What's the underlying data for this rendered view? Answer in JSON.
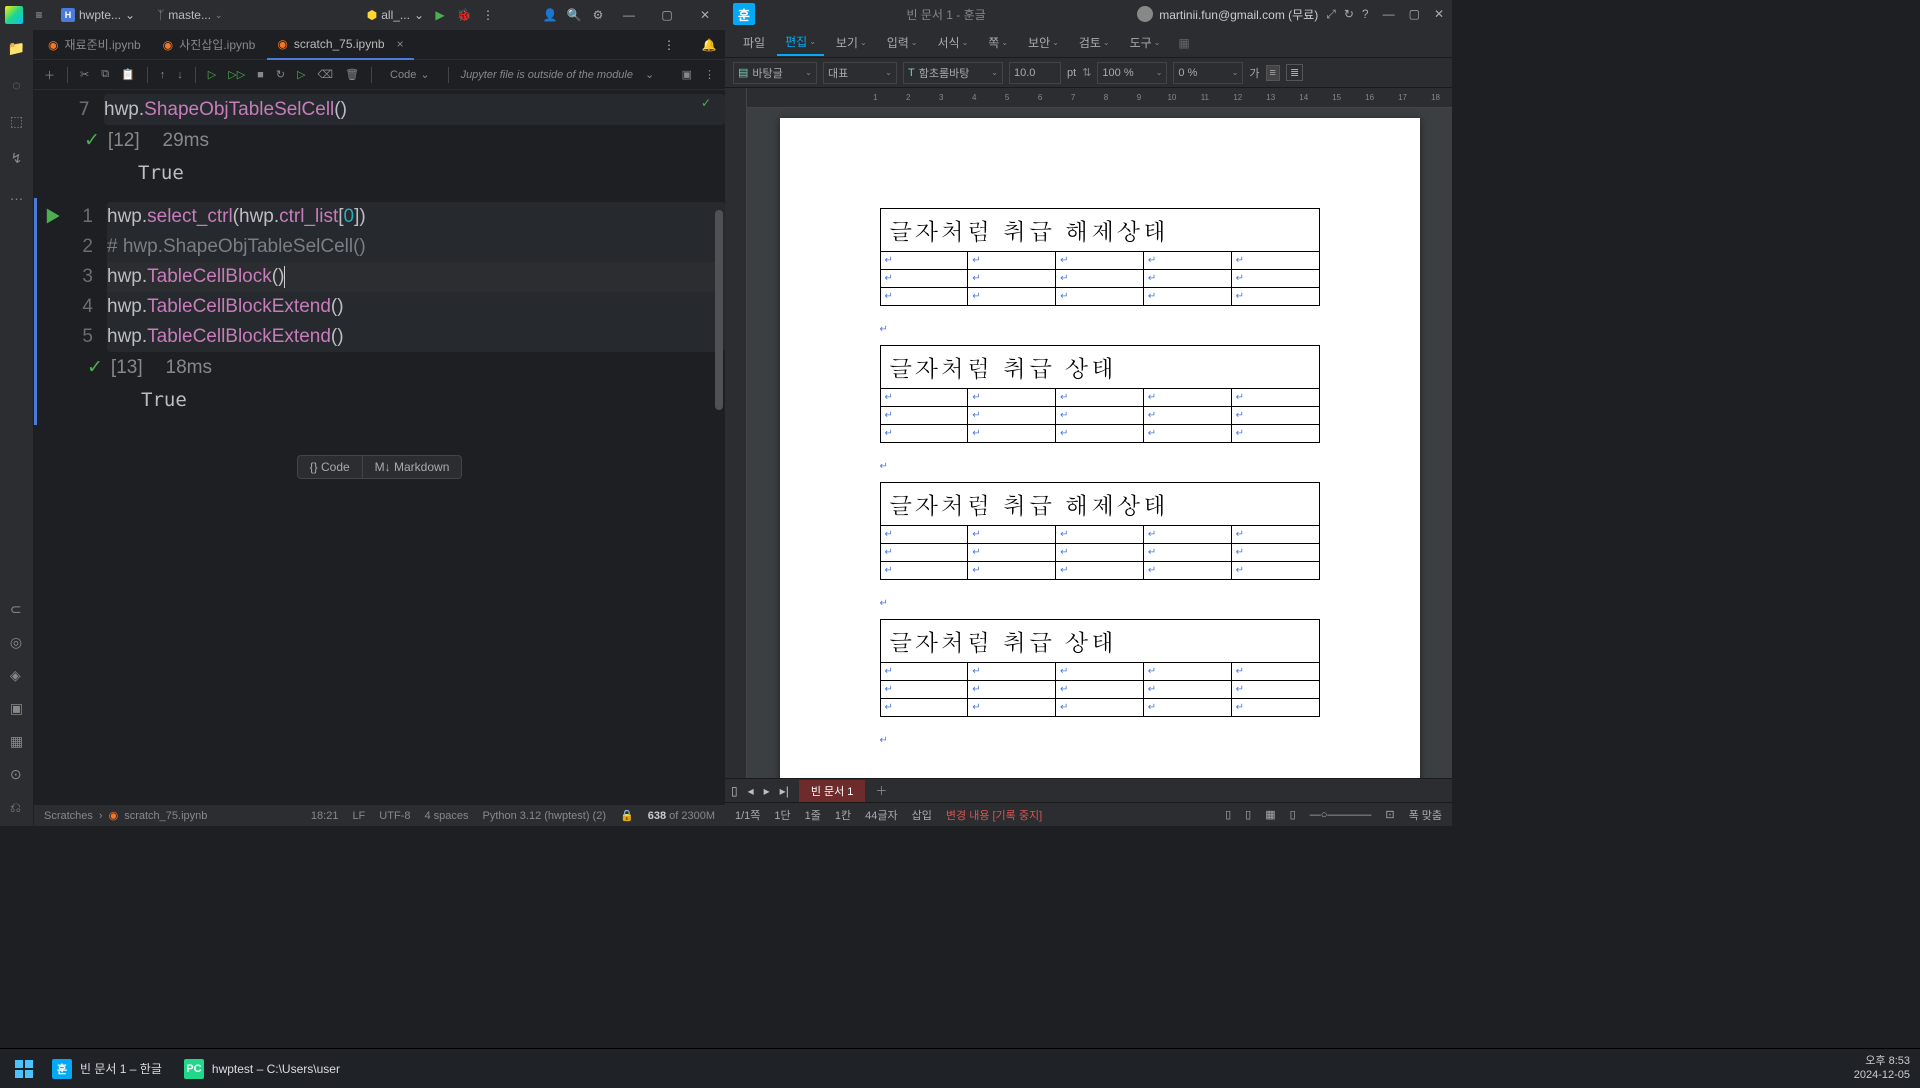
{
  "ide": {
    "project_name": "hwpte...",
    "git_branch": "maste...",
    "run_config": "all_...",
    "tabs": [
      {
        "name": "재료준비.ipynb",
        "active": false
      },
      {
        "name": "사진삽입.ipynb",
        "active": false
      },
      {
        "name": "scratch_75.ipynb",
        "active": true
      }
    ],
    "toolbar": {
      "lang_select": "Code",
      "warning": "Jupyter file is outside of the module"
    },
    "cells": [
      {
        "line_start": 7,
        "lines": [
          [
            {
              "t": "hwp",
              "c": "c-id"
            },
            {
              "t": ".",
              "c": "c-id"
            },
            {
              "t": "ShapeObjTableSelCell",
              "c": "c-prop"
            },
            {
              "t": "()",
              "c": "c-paren"
            }
          ]
        ],
        "exec_count": "[12]",
        "exec_time": "29ms",
        "output": "True",
        "has_run_marker": false,
        "check_top_right": true
      },
      {
        "line_start": 1,
        "lines": [
          [
            {
              "t": "hwp",
              "c": "c-id"
            },
            {
              "t": ".",
              "c": "c-id"
            },
            {
              "t": "select_ctrl",
              "c": "c-prop"
            },
            {
              "t": "(",
              "c": "c-paren"
            },
            {
              "t": "hwp",
              "c": "c-id"
            },
            {
              "t": ".",
              "c": "c-id"
            },
            {
              "t": "ctrl_list",
              "c": "c-prop"
            },
            {
              "t": "[",
              "c": "c-brack"
            },
            {
              "t": "0",
              "c": "c-num"
            },
            {
              "t": "]",
              "c": "c-brack"
            },
            {
              "t": ")",
              "c": "c-paren"
            }
          ],
          [
            {
              "t": "# hwp.ShapeObjTableSelCell()",
              "c": "c-comment"
            }
          ],
          [
            {
              "t": "hwp",
              "c": "c-id"
            },
            {
              "t": ".",
              "c": "c-id"
            },
            {
              "t": "TableCellBlock",
              "c": "c-prop"
            },
            {
              "t": "()",
              "c": "c-paren"
            }
          ],
          [
            {
              "t": "hwp",
              "c": "c-id"
            },
            {
              "t": ".",
              "c": "c-id"
            },
            {
              "t": "TableCellBlockExtend",
              "c": "c-prop"
            },
            {
              "t": "()",
              "c": "c-paren"
            }
          ],
          [
            {
              "t": "hwp",
              "c": "c-id"
            },
            {
              "t": ".",
              "c": "c-id"
            },
            {
              "t": "TableCellBlockExtend",
              "c": "c-prop"
            },
            {
              "t": "()",
              "c": "c-paren"
            }
          ]
        ],
        "cursor_line": 3,
        "exec_count": "[13]",
        "exec_time": "18ms",
        "output": "True",
        "has_run_marker": true
      }
    ],
    "add_buttons": {
      "code": "Code",
      "markdown": "Markdown"
    },
    "status": {
      "breadcrumb": [
        "Scratches",
        "scratch_75.ipynb"
      ],
      "cursor": "18:21",
      "line_sep": "LF",
      "encoding": "UTF-8",
      "indent": "4 spaces",
      "interpreter": "Python 3.12 (hwptest) (2)",
      "mem": "638 of 2300M"
    }
  },
  "hwp": {
    "doc_title": "빈 문서 1 - 훈글",
    "user": "martinii.fun@gmail.com (무료)",
    "menus": [
      "파일",
      "편집",
      "보기",
      "입력",
      "서식",
      "쪽",
      "보안",
      "검토",
      "도구"
    ],
    "active_menu_idx": 1,
    "toolbar": {
      "style_combo": "바탕글",
      "section_combo": "대표",
      "font_combo": "함초롬바탕",
      "font_size": "10.0",
      "font_unit": "pt",
      "zoom1": "100 %",
      "zoom2": "0 %",
      "baseline": "가"
    },
    "tables": [
      {
        "title": "글자처럼 취급 해제상태"
      },
      {
        "title": "글자처럼 취급 상태"
      },
      {
        "title": "글자처럼 취급 해제상태"
      },
      {
        "title": "글자처럼 취급 상태"
      }
    ],
    "doc_tab": "빈 문서 1",
    "status": {
      "page": "1/1쪽",
      "dan": "1단",
      "line": "1줄",
      "col": "1칸",
      "chars": "44글자",
      "mode": "삽입",
      "rec": "변경 내용 [기록 중지]",
      "fit": "폭 맞춤"
    }
  },
  "taskbar": {
    "items": [
      {
        "label": "빈 문서 1 – 한글",
        "ico": "훈"
      },
      {
        "label": "hwptest – C:\\Users\\user",
        "ico": "PC"
      }
    ],
    "time": "오후 8:53",
    "date": "2024-12-05"
  }
}
